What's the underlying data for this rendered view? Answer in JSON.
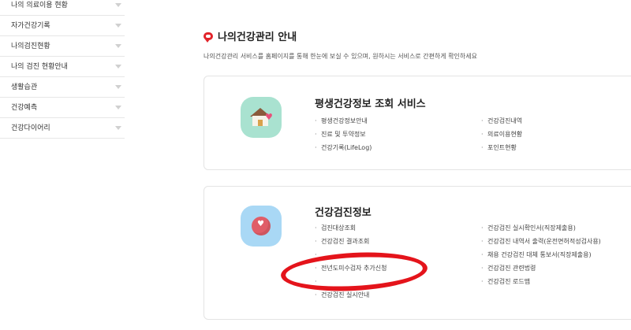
{
  "sidebar": {
    "items": [
      {
        "label": "나의 의료이용 현황"
      },
      {
        "label": "자가건강기록"
      },
      {
        "label": "나의검진현황"
      },
      {
        "label": "나의 검진 현황안내"
      },
      {
        "label": "생활습관"
      },
      {
        "label": "건강예측"
      },
      {
        "label": "건강다이어리"
      }
    ]
  },
  "main": {
    "title": "나의건강관리 안내",
    "description": "나의건강관리 서비스를 홈페이지를 통해 한눈에 보실 수 있으며, 원하시는 서비스로 간편하게 확인하세요",
    "cards": [
      {
        "title": "평생건강정보 조회 서비스",
        "icon": "house-heart-icon",
        "left_links": [
          "평생건강정보안내",
          "진료 및 투약정보",
          "건강기록(LifeLog)"
        ],
        "right_links": [
          "건강검진내역",
          "의료이용현황",
          "포인트현황"
        ]
      },
      {
        "title": "건강검진정보",
        "icon": "heart-ball-icon",
        "left_links": [
          "검진대상조회",
          "건강검진 결과조회",
          "",
          "전년도미수검자 추가신청",
          "",
          "건강검진 실시안내"
        ],
        "right_links": [
          "건강검진 실시확인서(직장제출용)",
          "건강검진 내역서 출력(운전면허적성검사용)",
          "채용 건강검진 대체 통보서(직장제출용)",
          "건강검진 관련법령",
          "건강검진 로드맵"
        ]
      }
    ]
  },
  "annotation": {
    "color": "#e4141b",
    "target": "전년도미수검자 추가신청"
  },
  "colors": {
    "accent": "#e2232a",
    "card1_icon_bg": "#a9e2d0",
    "card2_icon_bg": "#a9d8f5"
  }
}
